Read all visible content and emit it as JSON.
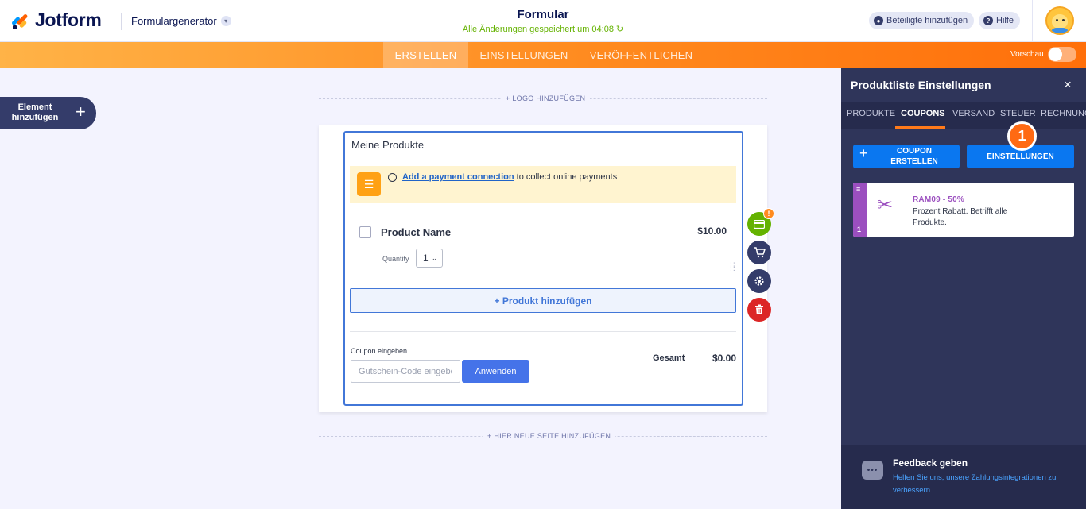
{
  "header": {
    "logo_text": "Jotform",
    "builder_menu": "Formulargenerator",
    "form_title": "Formular",
    "save_status": "Alle Änderungen gespeichert um 04:08",
    "invite_label": "Beteiligte hinzufügen",
    "help_label": "Hilfe"
  },
  "nav": {
    "tabs": [
      "ERSTELLEN",
      "EINSTELLUNGEN",
      "VERÖFFENTLICHEN"
    ],
    "active_tab": "ERSTELLEN",
    "preview_label": "Vorschau",
    "preview_on": false
  },
  "left": {
    "add_element_label": "Element hinzufügen"
  },
  "canvas": {
    "add_logo": "+ LOGO HINZUFÜGEN",
    "add_page": "+ HIER NEUE SEITE HINZUFÜGEN"
  },
  "form": {
    "products_title": "Meine Produkte",
    "notice_link": "Add a payment connection",
    "notice_rest": " to collect online payments",
    "product_name": "Product Name",
    "product_price": "$10.00",
    "quantity_label": "Quantity",
    "quantity_value": "1",
    "add_product": "+ Produkt hinzufügen",
    "coupon_label": "Coupon eingeben",
    "coupon_placeholder": "Gutschein-Code eingeben",
    "apply_label": "Anwenden",
    "total_label": "Gesamt",
    "total_value": "$0.00"
  },
  "tools": {
    "warning_badge": "!"
  },
  "panel": {
    "title": "Produktliste Einstellungen",
    "close": "×",
    "tabs": [
      "PRODUKTE",
      "COUPONS",
      "VERSAND",
      "STEUER",
      "RECHNUNG"
    ],
    "active_tab": "COUPONS",
    "create_coupon": "COUPON ERSTELLEN",
    "settings_button": "EINSTELLUNGEN",
    "step_badge": "1",
    "coupon": {
      "index": "1",
      "code": "RAM09 - 50%",
      "description": "Prozent Rabatt. Betrifft alle Produkte."
    },
    "feedback_title": "Feedback geben",
    "feedback_text": "Helfen Sie uns, unsere Zahlungsintegrationen zu verbessern."
  },
  "colors": {
    "brand_orange": "#ff6f0a",
    "primary_blue": "#0a77f0",
    "panel_bg": "#2f355a",
    "coupon_purple": "#9b4fbf",
    "success_green": "#64b200",
    "danger_red": "#dc2626"
  },
  "icons": [
    "jotform-logo-icon",
    "chevron-down-icon",
    "user-icon",
    "help-icon",
    "avatar",
    "plus-icon",
    "list-icon",
    "payment-card-icon",
    "cart-icon",
    "gear-icon",
    "trash-icon",
    "close-icon",
    "scissors-icon",
    "drag-handle-icon",
    "feedback-chat-icon"
  ]
}
